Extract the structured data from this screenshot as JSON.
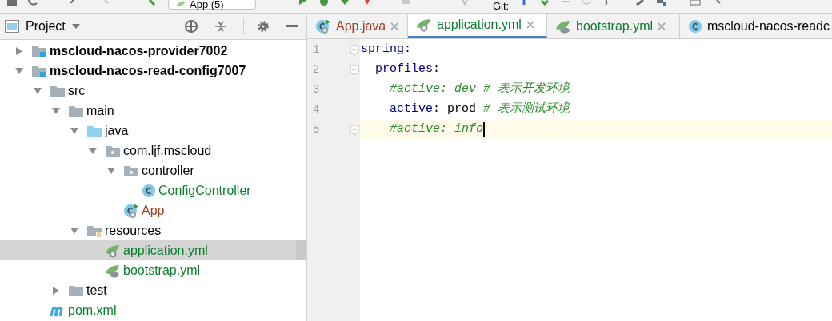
{
  "toolbar": {
    "run_config": "App (5)",
    "vcs_label": "Git:"
  },
  "project_panel": {
    "title": "Project",
    "tree": [
      {
        "label": "mscloud-nacos-provider7002",
        "kind": "module",
        "expanded": false,
        "selected": false,
        "color": "#000000"
      },
      {
        "label": "mscloud-nacos-read-config7007",
        "kind": "module",
        "expanded": true,
        "selected": false,
        "color": "#000000",
        "children": [
          {
            "label": "src",
            "kind": "folder",
            "expanded": true,
            "selected": false,
            "color": "#000000",
            "children": [
              {
                "label": "main",
                "kind": "folder",
                "expanded": true,
                "selected": false,
                "color": "#000000",
                "children": [
                  {
                    "label": "java",
                    "kind": "source",
                    "expanded": true,
                    "selected": false,
                    "color": "#000000",
                    "children": [
                      {
                        "label": "com.ljf.mscloud",
                        "kind": "package",
                        "expanded": true,
                        "selected": false,
                        "color": "#000000",
                        "children": [
                          {
                            "label": "controller",
                            "kind": "package",
                            "expanded": true,
                            "selected": false,
                            "color": "#000000",
                            "children": [
                              {
                                "label": "ConfigController",
                                "kind": "class",
                                "selected": false,
                                "color": "#0a7d2c"
                              }
                            ]
                          },
                          {
                            "label": "App",
                            "kind": "app",
                            "selected": false,
                            "color": "#a33a1a"
                          }
                        ]
                      }
                    ]
                  },
                  {
                    "label": "resources",
                    "kind": "resources",
                    "expanded": true,
                    "selected": false,
                    "color": "#000000",
                    "children": [
                      {
                        "label": "application.yml",
                        "kind": "yml-app",
                        "selected": true,
                        "color": "#0a7d2c"
                      },
                      {
                        "label": "bootstrap.yml",
                        "kind": "yml-boot",
                        "selected": false,
                        "color": "#0a7d2c"
                      }
                    ]
                  }
                ]
              },
              {
                "label": "test",
                "kind": "folder",
                "expanded": false,
                "selected": false,
                "color": "#000000"
              }
            ]
          },
          {
            "label": "pom.xml",
            "kind": "maven",
            "selected": false,
            "color": "#0a7d2c"
          }
        ]
      }
    ]
  },
  "editor_tabs": [
    {
      "label": "App.java",
      "kind": "app",
      "selected": false,
      "color": "#a33a1a"
    },
    {
      "label": "application.yml",
      "kind": "yml-app",
      "selected": true,
      "color": "#0a7d2c"
    },
    {
      "label": "bootstrap.yml",
      "kind": "yml-boot",
      "selected": false,
      "color": "#0a7d2c"
    },
    {
      "label": "mscloud-nacos-readc",
      "kind": "class-cut",
      "selected": false,
      "color": "#000000"
    }
  ],
  "editor": {
    "lines": [
      {
        "number": "1",
        "current": false,
        "fold": true,
        "tokens": [
          {
            "text": "spring",
            "kind": "key"
          },
          {
            "text": ":",
            "kind": "plain"
          }
        ]
      },
      {
        "number": "2",
        "current": false,
        "fold": true,
        "tokens": [
          {
            "text": "  profiles",
            "kind": "key"
          },
          {
            "text": ":",
            "kind": "plain"
          }
        ]
      },
      {
        "number": "3",
        "current": false,
        "fold": false,
        "tokens": [
          {
            "text": "    #active: dev # 表示开发环境",
            "kind": "comment"
          }
        ]
      },
      {
        "number": "4",
        "current": false,
        "fold": false,
        "tokens": [
          {
            "text": "    active",
            "kind": "key"
          },
          {
            "text": ": prod ",
            "kind": "plain"
          },
          {
            "text": "# 表示测试环境",
            "kind": "comment"
          }
        ]
      },
      {
        "number": "5",
        "current": true,
        "fold": true,
        "tokens": [
          {
            "text": "    #active: info",
            "kind": "comment"
          }
        ]
      }
    ]
  }
}
